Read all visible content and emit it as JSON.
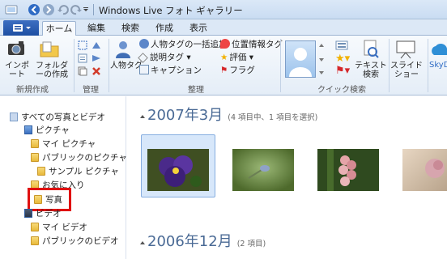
{
  "window": {
    "title": "Windows Live フォト ギャラリー"
  },
  "ribbon": {
    "tabs": [
      "ホーム",
      "編集",
      "検索",
      "作成",
      "表示"
    ],
    "new_group": {
      "import": "インポート",
      "folder": "フォルダーの作成",
      "label": "新規作成"
    },
    "manage_group": {
      "label": "管理"
    },
    "organize_group": {
      "people_tag": "人物タグ",
      "batch_people": "人物タグの一括追加",
      "desc_tag": "説明タグ",
      "caption": "キャプション",
      "geotag": "位置情報タグ",
      "rating": "評価",
      "flag": "フラグ",
      "label": "整理"
    },
    "quick_find": {
      "text_search": "テキスト検索",
      "label": "クイック検索"
    },
    "share_group": {
      "slideshow": "スライドショー",
      "skydrive": "SkyD"
    }
  },
  "sidebar": {
    "all_photos": "すべての写真とビデオ",
    "pictures": "ピクチャ",
    "my_pictures": "マイ ピクチャ",
    "public_pictures": "パブリックのピクチャ",
    "sample_pictures": "サンプル ピクチャ",
    "favorites": "お気に入り",
    "photos": "写真",
    "videos": "ビデオ",
    "my_videos": "マイ ビデオ",
    "public_videos": "パブリックのビデオ"
  },
  "main": {
    "groups": [
      {
        "date": "2007年3月",
        "info": "(4 項目中、1 項目を選択)"
      },
      {
        "date": "2006年12月",
        "info": "(2 項目)"
      }
    ]
  },
  "colors": {
    "accent": "#1e4fa3",
    "highlight": "#e01010",
    "date_header": "#4a6a95"
  }
}
